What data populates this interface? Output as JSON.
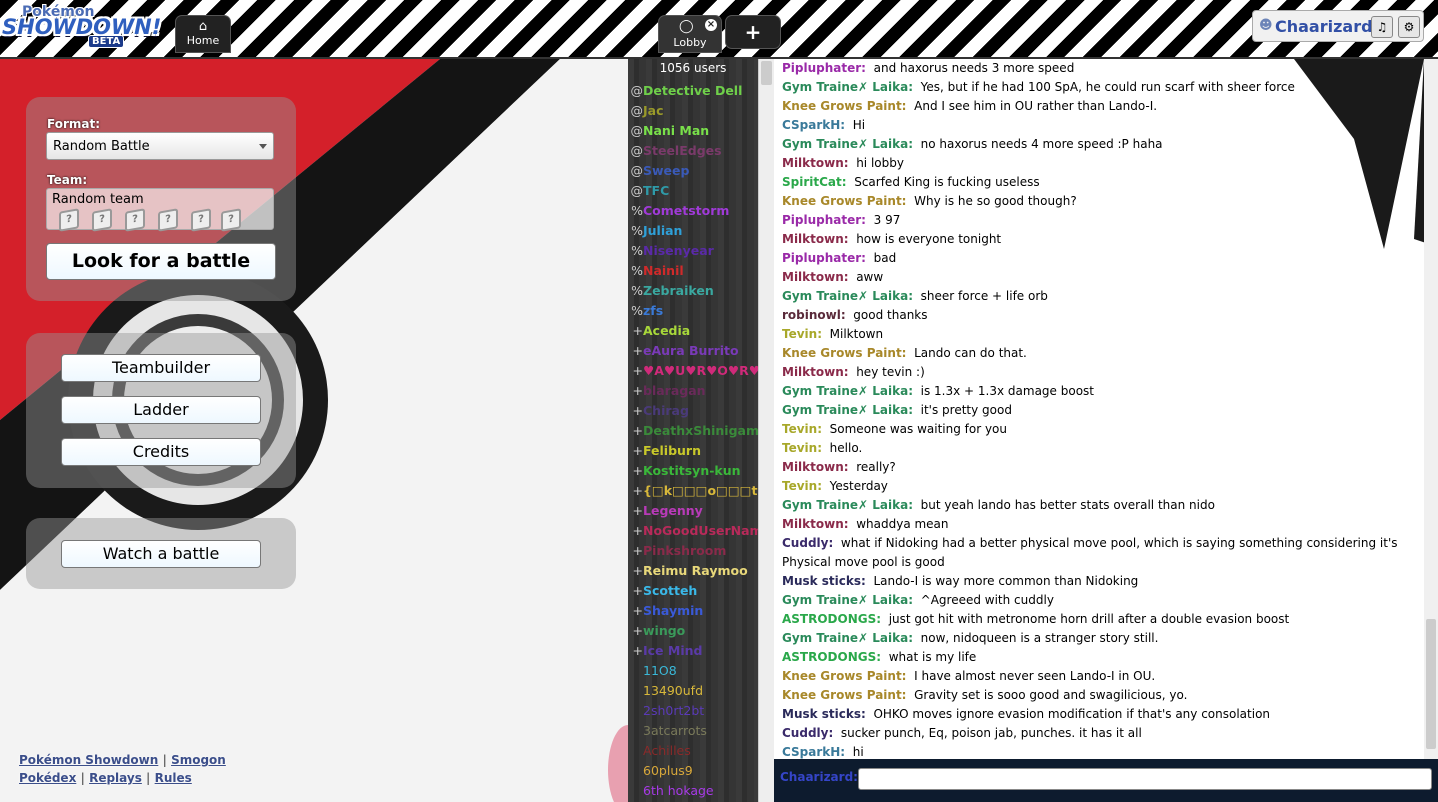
{
  "header": {
    "logo_line1": "Pokémon",
    "logo_line2": "SHOWDOWN!",
    "logo_badge": "BETA",
    "home_tab": {
      "label": "Home",
      "icon": "home-icon"
    },
    "lobby_tab": {
      "label": "Lobby",
      "icon": "chat-bubble-icon",
      "close_icon": "close-icon"
    },
    "new_tab": {
      "label": "+"
    },
    "user": {
      "name": "Chaarizard",
      "icon": "user-icon",
      "sound_icon": "speaker-icon",
      "settings_icon": "gear-icon"
    }
  },
  "main_menu": {
    "format_label": "Format:",
    "format_value": "Random Battle",
    "team_label": "Team:",
    "team_value": "Random team",
    "team_slot_glyph": "?",
    "search_button": "Look for a battle",
    "teambuilder_button": "Teambuilder",
    "ladder_button": "Ladder",
    "credits_button": "Credits",
    "watch_button": "Watch a battle"
  },
  "footer": {
    "links": [
      "Pokémon Showdown",
      "Smogon",
      "Pokédex",
      "Replays",
      "Rules"
    ],
    "separator": "|"
  },
  "userlist": {
    "count_text": "1056 users",
    "users": [
      {
        "rank": "@",
        "name": "Detective Dell",
        "color": "#6fd04a"
      },
      {
        "rank": "@",
        "name": "Jac",
        "color": "#9a9a2a"
      },
      {
        "rank": "@",
        "name": "Nani Man",
        "color": "#79e04a"
      },
      {
        "rank": "@",
        "name": "SteelEdges",
        "color": "#7a3a6a"
      },
      {
        "rank": "@",
        "name": "Sweep",
        "color": "#3a5ab8"
      },
      {
        "rank": "@",
        "name": "TFC",
        "color": "#2f9aa8"
      },
      {
        "rank": "%",
        "name": "Cometstorm",
        "color": "#a03ad8"
      },
      {
        "rank": "%",
        "name": "Julian",
        "color": "#2fa0d8"
      },
      {
        "rank": "%",
        "name": "Nisenyear",
        "color": "#5a2aa8"
      },
      {
        "rank": "%",
        "name": "Nainil",
        "color": "#d02a2a"
      },
      {
        "rank": "%",
        "name": "Zebraiken",
        "color": "#3aa8a0"
      },
      {
        "rank": "%",
        "name": "zfs",
        "color": "#3a7ad8"
      },
      {
        "rank": "+",
        "name": "Acedia",
        "color": "#a8d83a"
      },
      {
        "rank": "+",
        "name": "eAura Burrito",
        "color": "#7a3ab8"
      },
      {
        "rank": "+",
        "name": "♥A♥U♥R♥O♥R♥A♥",
        "color": "#d02a7a"
      },
      {
        "rank": "+",
        "name": "blaragan",
        "color": "#6a2a5a"
      },
      {
        "rank": "+",
        "name": "Chirag",
        "color": "#4a3a7a"
      },
      {
        "rank": "+",
        "name": "DeathxShinigami",
        "color": "#3a8a3a"
      },
      {
        "rank": "+",
        "name": "Feliburn",
        "color": "#c8c82a"
      },
      {
        "rank": "+",
        "name": "Kostitsyn-kun",
        "color": "#3ab83a"
      },
      {
        "rank": "+",
        "name": "{□k□□□o□□□t",
        "color": "#d8b83a"
      },
      {
        "rank": "+",
        "name": "Legenny",
        "color": "#b83ab8"
      },
      {
        "rank": "+",
        "name": "NoGoodUserName",
        "color": "#b82a5a"
      },
      {
        "rank": "+",
        "name": "Pinkshroom",
        "color": "#8a2a4a"
      },
      {
        "rank": "+",
        "name": "Reimu Raymoo",
        "color": "#e8d87a"
      },
      {
        "rank": "+",
        "name": "Scotteh",
        "color": "#3ab8e8"
      },
      {
        "rank": "+",
        "name": "Shaymin",
        "color": "#3a5ad8"
      },
      {
        "rank": "+",
        "name": "wingo",
        "color": "#3a9a5a"
      },
      {
        "rank": "+",
        "name": "Ice Mind",
        "color": "#5a3aa8"
      },
      {
        "rank": "",
        "name": "11O8",
        "color": "#3ab8d8"
      },
      {
        "rank": "",
        "name": "13490ufd",
        "color": "#d8b83a"
      },
      {
        "rank": "",
        "name": "2sh0rt2bt",
        "color": "#5a3ab8"
      },
      {
        "rank": "",
        "name": "3atcarrots",
        "color": "#7a7a5a"
      },
      {
        "rank": "",
        "name": "Achilles",
        "color": "#8a2a2a"
      },
      {
        "rank": "",
        "name": "60plus9",
        "color": "#d8a83a"
      },
      {
        "rank": "",
        "name": "6th hokage",
        "color": "#a83ae8"
      }
    ]
  },
  "chat": {
    "messages": [
      {
        "user": "Pipluphater:",
        "text": "and haxorus needs 3 more speed",
        "color": "#9a2aa8"
      },
      {
        "user": "Gym Traine✗ Laika:",
        "text": "Yes, but if he had 100 SpA, he could run scarf with sheer force",
        "color": "#2a8a5a"
      },
      {
        "user": "Knee Grows Paint:",
        "text": "And I see him in OU rather than Lando-I.",
        "color": "#a8882a"
      },
      {
        "user": "CSparkH:",
        "text": "Hi",
        "color": "#3a7a9a"
      },
      {
        "user": "Gym Traine✗ Laika:",
        "text": "no haxorus needs 4 more speed :P haha",
        "color": "#2a8a5a"
      },
      {
        "user": "Milktown:",
        "text": "hi lobby",
        "color": "#8a2a4a"
      },
      {
        "user": "SpiritCat:",
        "text": "Scarfed King is fucking useless",
        "color": "#2aa84a"
      },
      {
        "user": "Knee Grows Paint:",
        "text": "Why is he so good though?",
        "color": "#a8882a"
      },
      {
        "user": "Pipluphater:",
        "text": "3 97",
        "color": "#9a2aa8"
      },
      {
        "user": "Milktown:",
        "text": "how is everyone tonight",
        "color": "#8a2a4a"
      },
      {
        "user": "Pipluphater:",
        "text": "bad",
        "color": "#9a2aa8"
      },
      {
        "user": "Milktown:",
        "text": "aww",
        "color": "#8a2a4a"
      },
      {
        "user": "Gym Traine✗ Laika:",
        "text": "sheer force + life orb",
        "color": "#2a8a5a"
      },
      {
        "user": "robinowl:",
        "text": "good thanks",
        "color": "#5a2a3a"
      },
      {
        "user": "Tevin:",
        "text": "Milktown",
        "color": "#a8a82a"
      },
      {
        "user": "Knee Grows Paint:",
        "text": "Lando can do that.",
        "color": "#a8882a"
      },
      {
        "user": "Milktown:",
        "text": "hey tevin :)",
        "color": "#8a2a4a"
      },
      {
        "user": "Gym Traine✗ Laika:",
        "text": "is 1.3x + 1.3x damage boost",
        "color": "#2a8a5a"
      },
      {
        "user": "Gym Traine✗ Laika:",
        "text": "it's pretty good",
        "color": "#2a8a5a"
      },
      {
        "user": "Tevin:",
        "text": "Someone was waiting for you",
        "color": "#a8a82a"
      },
      {
        "user": "Tevin:",
        "text": "hello.",
        "color": "#a8a82a"
      },
      {
        "user": "Milktown:",
        "text": "really?",
        "color": "#8a2a4a"
      },
      {
        "user": "Tevin:",
        "text": "Yesterday",
        "color": "#a8a82a"
      },
      {
        "user": "Gym Traine✗ Laika:",
        "text": "but yeah lando has better stats overall than nido",
        "color": "#2a8a5a"
      },
      {
        "user": "Milktown:",
        "text": "whaddya mean",
        "color": "#8a2a4a"
      },
      {
        "user": "Cuddly:",
        "text": "what if Nidoking had a better physical move pool, which is saying something considering it's Physical move pool is good",
        "color": "#3a2a6a"
      },
      {
        "user": "Musk sticks:",
        "text": "Lando-I is way more common than Nidoking",
        "color": "#2a2a5a"
      },
      {
        "user": "Gym Traine✗ Laika:",
        "text": "^Agreeed with cuddly",
        "color": "#2a8a5a"
      },
      {
        "user": "ASTRODONGS:",
        "text": "just got hit with metronome horn drill after a double evasion boost",
        "color": "#2aa84a"
      },
      {
        "user": "Gym Traine✗ Laika:",
        "text": "now, nidoqueen is a stranger story still.",
        "color": "#2a8a5a"
      },
      {
        "user": "ASTRODONGS:",
        "text": "what is my life",
        "color": "#2aa84a"
      },
      {
        "user": "Knee Grows Paint:",
        "text": "I have almost never seen Lando-I in OU.",
        "color": "#a8882a"
      },
      {
        "user": "Knee Grows Paint:",
        "text": "Gravity set is sooo good and swagilicious, yo.",
        "color": "#a8882a"
      },
      {
        "user": "Musk sticks:",
        "text": "OHKO moves ignore evasion modification if that's any consolation",
        "color": "#2a2a5a"
      },
      {
        "user": "Cuddly:",
        "text": "sucker punch, Eq, poison jab, punches. it has it all",
        "color": "#3a2a6a"
      },
      {
        "user": "CSparkH:",
        "text": "hi",
        "color": "#3a7a9a"
      }
    ],
    "input_label": "Chaarizard:",
    "input_value": ""
  }
}
